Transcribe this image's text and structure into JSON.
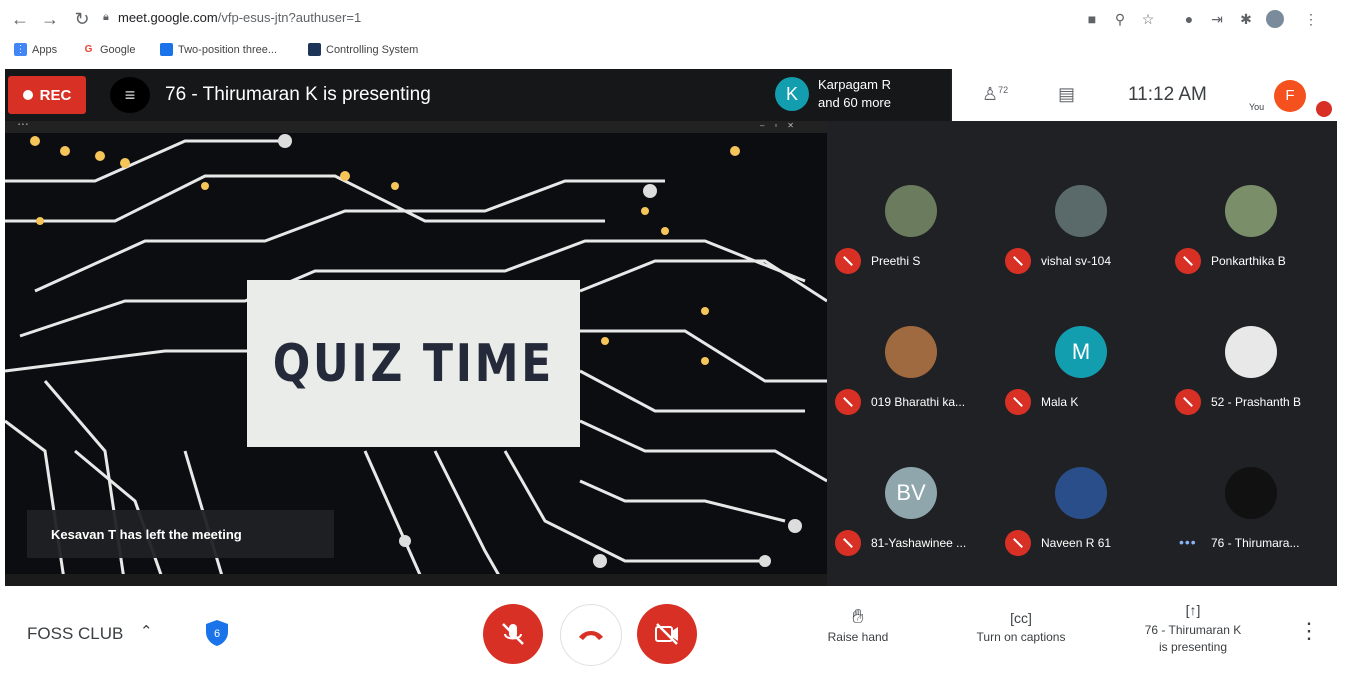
{
  "browser": {
    "url_host": "meet.google.com",
    "url_path": "/vfp-esus-jtn?authuser=1",
    "bookmarks": [
      "Apps",
      "Google",
      "Two-position three...",
      "Controlling System"
    ]
  },
  "meet_header": {
    "rec_label": "REC",
    "presenting_title": "76 - Thirumaran K is presenting",
    "presenter_summary_avatar": "K",
    "presenter_summary_line1": "Karpagam R",
    "presenter_summary_line2": "and 60 more",
    "people_count": "72",
    "clock": "11:12 AM",
    "you_label": "You",
    "me_avatar": "F"
  },
  "presentation": {
    "slide_text": "QUIZ TIME",
    "toast": "Kesavan T has left the meeting"
  },
  "participants": [
    {
      "name": "Preethi S",
      "avatar": "",
      "avatar_color": "#6b7b5e",
      "muted": true
    },
    {
      "name": "vishal sv-104",
      "avatar": "",
      "avatar_color": "#5a6a6a",
      "muted": true
    },
    {
      "name": "Ponkarthika B",
      "avatar": "",
      "avatar_color": "#7a8e6a",
      "muted": true
    },
    {
      "name": "019 Bharathi ka...",
      "avatar": "",
      "avatar_color": "#a06a40",
      "muted": true
    },
    {
      "name": "Mala K",
      "avatar": "M",
      "avatar_color": "#129eaf",
      "muted": true
    },
    {
      "name": "52 - Prashanth B",
      "avatar": "",
      "avatar_color": "#e8e8e8",
      "muted": true
    },
    {
      "name": "81-Yashawinee ...",
      "avatar": "BV",
      "avatar_color": "#8fa6ad",
      "muted": true
    },
    {
      "name": "Naveen R 61",
      "avatar": "",
      "avatar_color": "#2a4e8a",
      "muted": true
    },
    {
      "name": "76 - Thirumara...",
      "avatar": "",
      "avatar_color": "#111111",
      "muted": false
    }
  ],
  "controls": {
    "meeting_name": "FOSS CLUB",
    "raise_hand": "Raise hand",
    "captions": "Turn on captions",
    "present_line1": "76 - Thirumaran K",
    "present_line2": "is presenting"
  },
  "colors": {
    "red": "#d93025",
    "teal": "#129eaf",
    "meet_bg": "#202124"
  }
}
